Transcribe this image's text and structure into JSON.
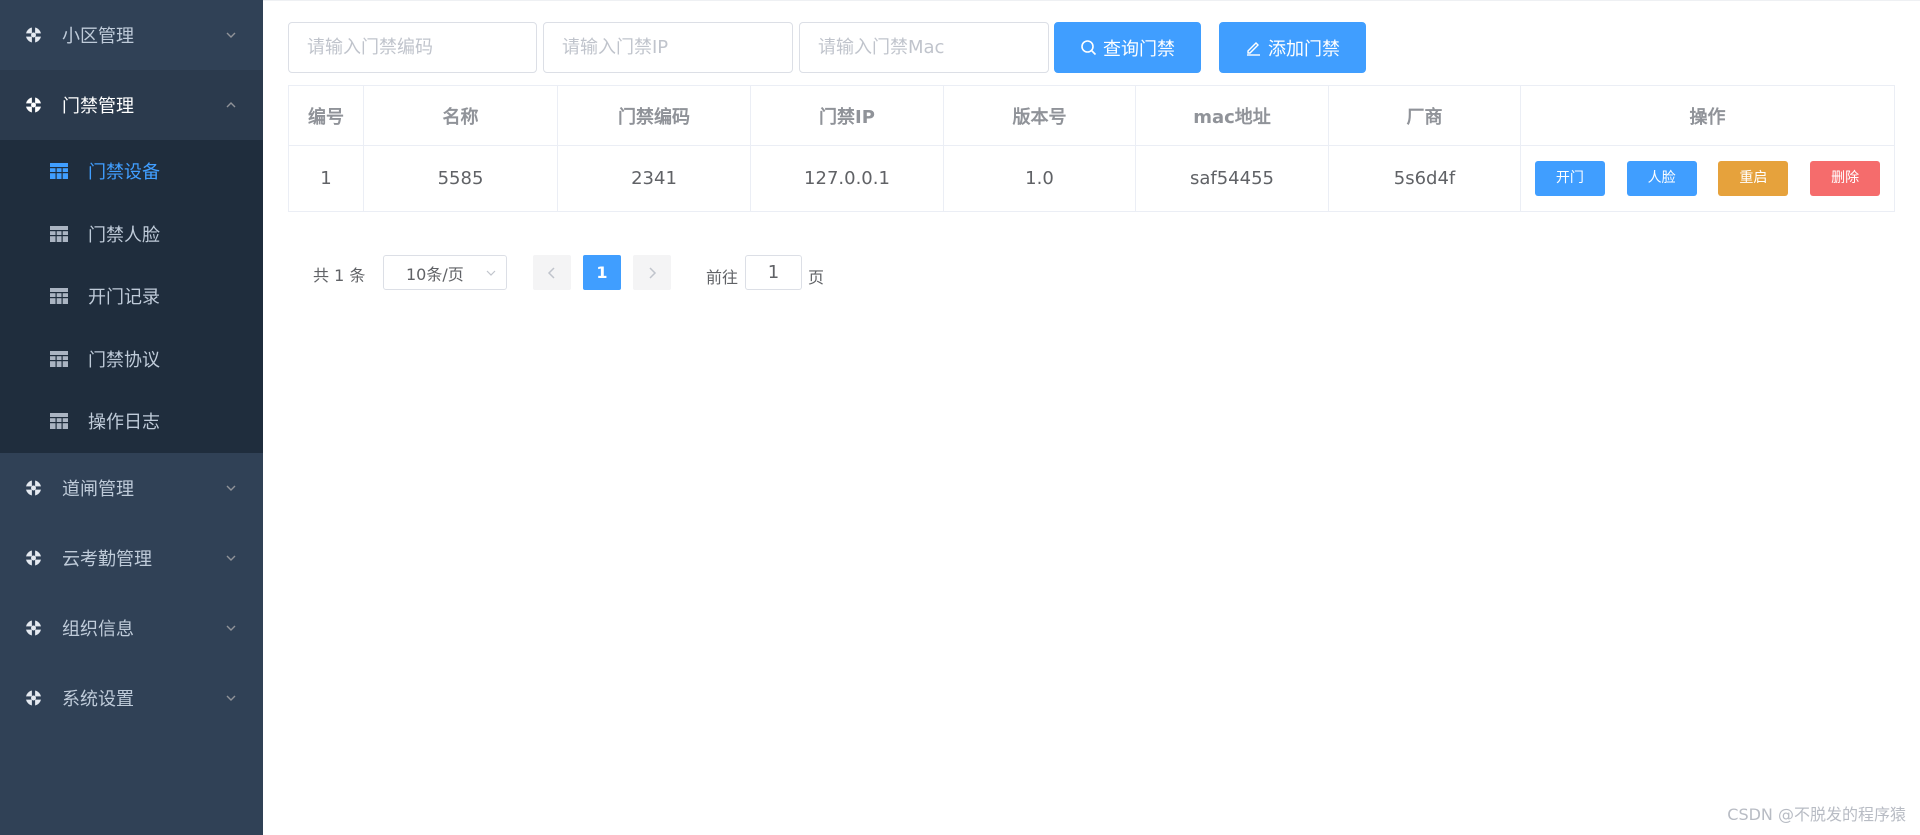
{
  "sidebar": {
    "menus": [
      {
        "label": "小区管理"
      },
      {
        "label": "门禁管理"
      },
      {
        "label": "道闸管理"
      },
      {
        "label": "云考勤管理"
      },
      {
        "label": "组织信息"
      },
      {
        "label": "系统设置"
      }
    ],
    "submenu": [
      {
        "label": "门禁设备"
      },
      {
        "label": "门禁人脸"
      },
      {
        "label": "开门记录"
      },
      {
        "label": "门禁协议"
      },
      {
        "label": "操作日志"
      }
    ]
  },
  "search": {
    "code_placeholder": "请输入门禁编码",
    "ip_placeholder": "请输入门禁IP",
    "mac_placeholder": "请输入门禁Mac",
    "query_label": "查询门禁",
    "add_label": "添加门禁"
  },
  "table": {
    "headers": [
      "编号",
      "名称",
      "门禁编码",
      "门禁IP",
      "版本号",
      "mac地址",
      "厂商",
      "操作"
    ],
    "rows": [
      {
        "id": "1",
        "name": "5585",
        "code": "2341",
        "ip": "127.0.0.1",
        "version": "1.0",
        "mac": "saf54455",
        "vendor": "5s6d4f"
      }
    ],
    "actions": {
      "open": "开门",
      "face": "人脸",
      "restart": "重启",
      "delete": "删除"
    }
  },
  "pagination": {
    "total": "共 1 条",
    "page_size": "10条/页",
    "current_page": "1",
    "goto_prefix": "前往",
    "goto_value": "1",
    "goto_suffix": "页"
  },
  "watermark": "CSDN @不脱发的程序猿",
  "colors": {
    "sidebar_bg": "#304156",
    "submenu_bg": "#1f2d3d",
    "primary": "#409eff",
    "warning": "#e6a23c",
    "danger": "#f56c6c"
  }
}
